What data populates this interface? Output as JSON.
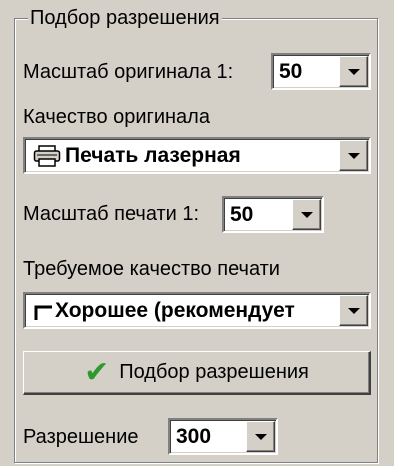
{
  "group": {
    "title": "Подбор разрешения"
  },
  "original_scale": {
    "label": "Масштаб оригинала 1:",
    "value": "50"
  },
  "original_quality": {
    "label": "Качество оригинала",
    "value": "Печать лазерная",
    "icon": "printer-icon"
  },
  "print_scale": {
    "label": "Масштаб печати 1:",
    "value": "50"
  },
  "print_quality": {
    "label": "Требуемое качество печати",
    "value": "Хорошее (рекомендует",
    "icon": "corner-mark-icon"
  },
  "pick_button": {
    "label": "Подбор разрешения",
    "icon": "checkmark-icon",
    "icon_color": "#2e9a2e"
  },
  "resolution": {
    "label": "Разрешение",
    "value": "300"
  }
}
